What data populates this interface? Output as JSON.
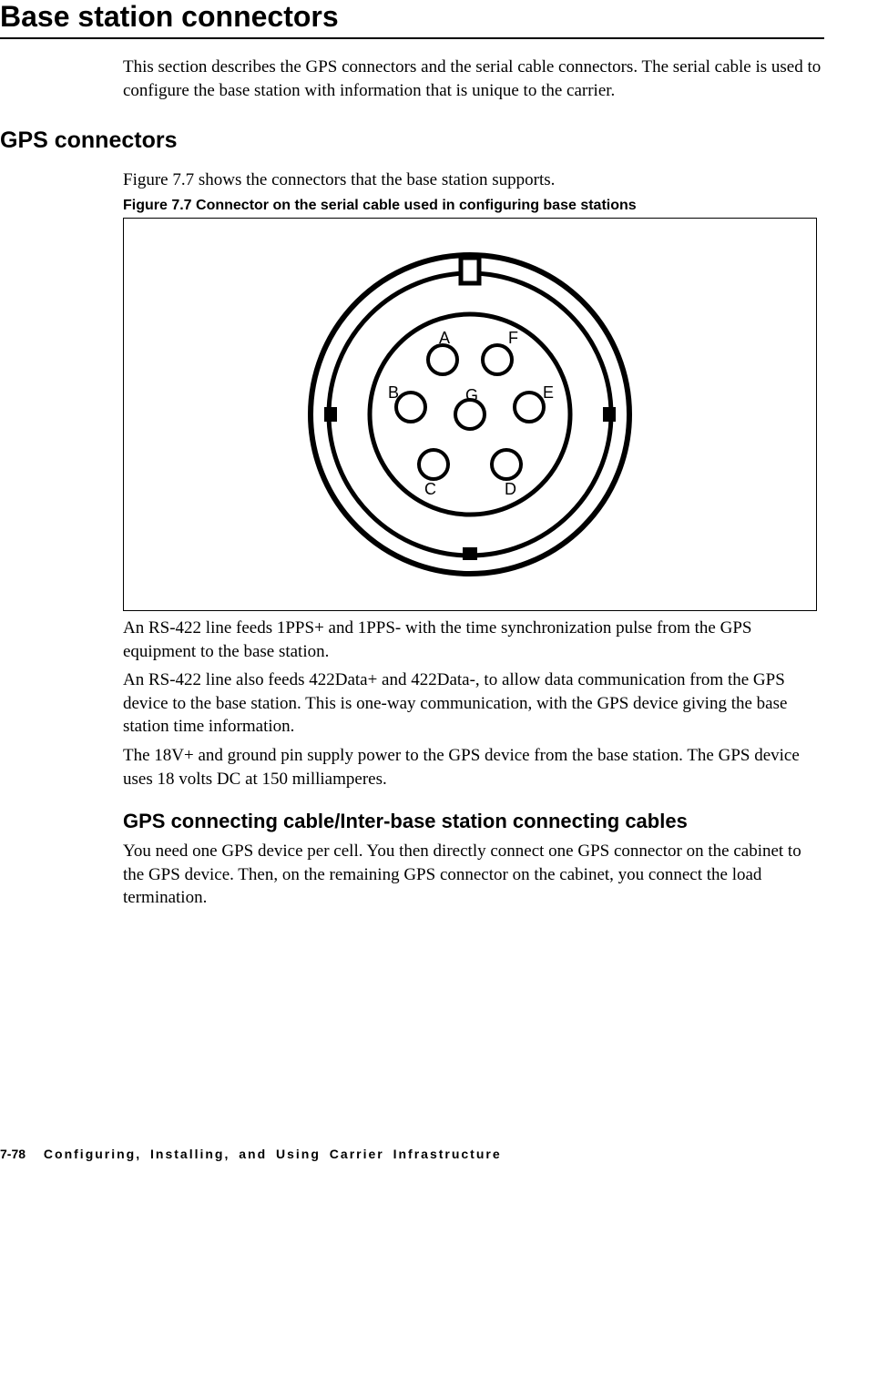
{
  "title": "Base station connectors",
  "intro": "This section describes the GPS connectors and the serial cable connectors. The serial cable is used to configure the base station with information that is unique to the carrier.",
  "section2": {
    "heading": "GPS connectors",
    "p1": "Figure 7.7 shows the connectors that the base station supports.",
    "figcap": "Figure 7.7   Connector on the serial cable used in configuring base stations",
    "p2": "An RS-422 line feeds 1PPS+ and 1PPS- with the time synchronization pulse from the GPS equipment to the base station.",
    "p3": "An RS-422 line also feeds 422Data+ and 422Data-, to allow data communication from the GPS device to the base station. This is one-way communication, with the GPS device giving the base station time information.",
    "p4": "The 18V+ and ground pin supply power to the GPS device from the base station. The GPS device uses 18 volts DC at 150 milliamperes."
  },
  "section3": {
    "heading": "GPS connecting cable/Inter-base station connecting cables",
    "p1": "You need one GPS device per cell. You then directly connect one GPS connector on the cabinet to the GPS device. Then, on the remaining GPS connector on the cabinet, you connect the load termination."
  },
  "connector": {
    "pins": {
      "A": "A",
      "B": "B",
      "C": "C",
      "D": "D",
      "E": "E",
      "F": "F",
      "G": "G"
    }
  },
  "footer": {
    "pagenum": "7-78",
    "text": "Configuring, Installing, and Using Carrier Infrastructure"
  }
}
